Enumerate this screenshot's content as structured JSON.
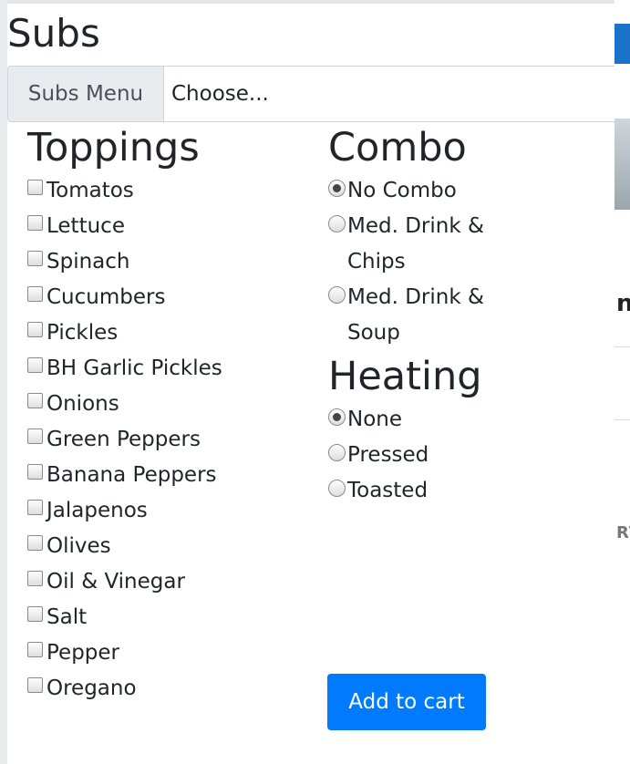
{
  "modal": {
    "title": "Subs",
    "menu_label": "Subs Menu",
    "menu_select_value": "Choose..."
  },
  "toppings": {
    "title": "Toppings",
    "items": [
      "Tomatos",
      "Lettuce",
      "Spinach",
      "Cucumbers",
      "Pickles",
      "BH Garlic Pickles",
      "Onions",
      "Green Peppers",
      "Banana Peppers",
      "Jalapenos",
      "Olives",
      "Oil & Vinegar",
      "Salt",
      "Pepper",
      "Oregano"
    ]
  },
  "combo": {
    "title": "Combo",
    "options": [
      "No Combo",
      "Med. Drink & Chips",
      "Med. Drink & Soup"
    ],
    "selected": 0
  },
  "heating": {
    "title": "Heating",
    "options": [
      "None",
      "Pressed",
      "Toasted"
    ],
    "selected": 0
  },
  "add_to_cart_label": "Add to cart",
  "colors": {
    "primary": "#007bff",
    "prepend_bg": "#e9ecef",
    "text": "#212529"
  }
}
